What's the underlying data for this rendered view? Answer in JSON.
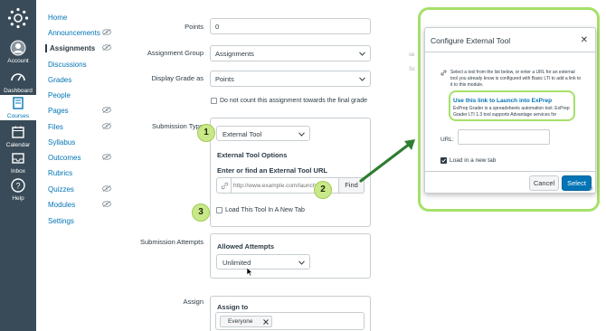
{
  "global_nav": {
    "items": [
      {
        "label": "Account",
        "icon": "account-icon"
      },
      {
        "label": "Dashboard",
        "icon": "dashboard-icon"
      },
      {
        "label": "Courses",
        "icon": "courses-icon",
        "active": true
      },
      {
        "label": "Calendar",
        "icon": "calendar-icon"
      },
      {
        "label": "Inbox",
        "icon": "inbox-icon"
      },
      {
        "label": "Help",
        "icon": "help-icon"
      }
    ]
  },
  "course_nav": {
    "items": [
      {
        "label": "Home"
      },
      {
        "label": "Announcements",
        "hidden_icon": true
      },
      {
        "label": "Assignments",
        "active": true,
        "hidden_icon": true
      },
      {
        "label": "Discussions"
      },
      {
        "label": "Grades"
      },
      {
        "label": "People"
      },
      {
        "label": "Pages",
        "hidden_icon": true
      },
      {
        "label": "Files",
        "hidden_icon": true
      },
      {
        "label": "Syllabus"
      },
      {
        "label": "Outcomes",
        "hidden_icon": true
      },
      {
        "label": "Rubrics"
      },
      {
        "label": "Quizzes",
        "hidden_icon": true
      },
      {
        "label": "Modules",
        "hidden_icon": true
      },
      {
        "label": "Settings"
      }
    ]
  },
  "form": {
    "points_label": "Points",
    "points_value": "0",
    "group_label": "Assignment Group",
    "group_value": "Assignments",
    "display_label": "Display Grade as",
    "display_value": "Points",
    "final_grade_label": "Do not count this assignment towards the final grade",
    "submission_type_label": "Submission Type",
    "submission_type_value": "External Tool",
    "ext_options_heading": "External Tool Options",
    "ext_url_heading": "Enter or find an External Tool URL",
    "ext_url_placeholder": "http://www.example.com/launch",
    "find_button": "Find",
    "new_tab_label": "Load This Tool In A New Tab",
    "attempts_label": "Submission Attempts",
    "attempts_heading": "Allowed Attempts",
    "attempts_value": "Unlimited",
    "assign_label": "Assign",
    "assign_to_heading": "Assign to",
    "assignee_chip": "Everyone"
  },
  "steps": [
    "1",
    "2",
    "3"
  ],
  "modal": {
    "title": "Configure External Tool",
    "info": "Select a tool from the list below, or enter a URL for an external tool you already know is configured with Basic LTI to add a link to it to this module.",
    "tool_link": "Use this link to Launch into ExPrep",
    "tool_desc": "ExPrep Grader is a spreadsheets automation tool. ExPrep Grader LTI 1.3 tool supports Advantage services for",
    "url_label": "URL:",
    "new_tab_label": "Load in a new tab",
    "cancel": "Cancel",
    "select": "Select"
  },
  "colors": {
    "nav_bg": "#394b58",
    "link": "#0374b5",
    "highlight": "#a6e069",
    "step_fill": "#c9e88a",
    "arrow": "#2e7d32",
    "primary_button": "#0374b5"
  }
}
